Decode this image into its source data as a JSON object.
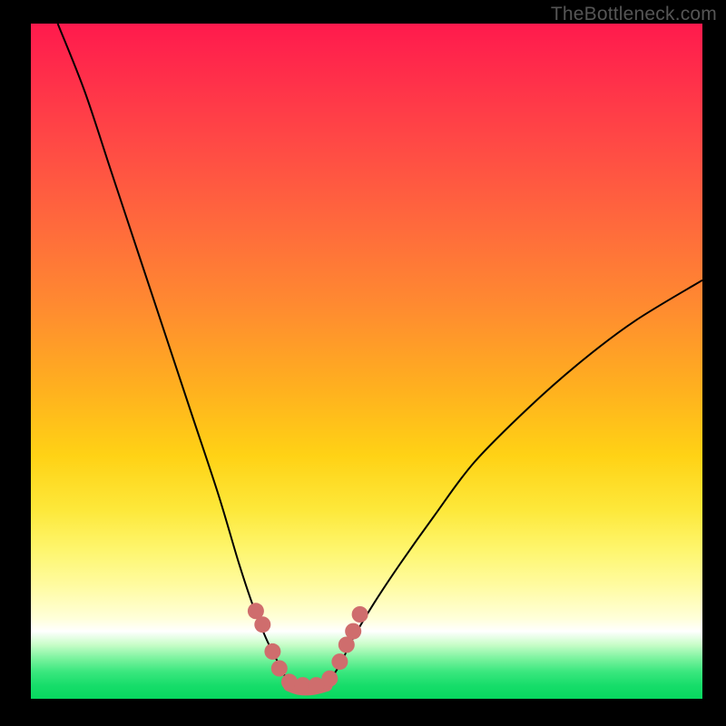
{
  "watermark": "TheBottleneck.com",
  "chart_data": {
    "type": "line",
    "title": "",
    "xlabel": "",
    "ylabel": "",
    "xlim": [
      0,
      100
    ],
    "ylim": [
      0,
      100
    ],
    "grid": false,
    "legend": false,
    "annotations": [],
    "series": [
      {
        "name": "left-curve",
        "x": [
          4,
          8,
          12,
          16,
          20,
          24,
          28,
          31,
          33,
          35,
          37,
          38.5
        ],
        "y": [
          100,
          90,
          78,
          66,
          54,
          42,
          30,
          20,
          14,
          9,
          5,
          2
        ]
      },
      {
        "name": "right-curve",
        "x": [
          44,
          46,
          48,
          51,
          55,
          60,
          66,
          74,
          82,
          90,
          100
        ],
        "y": [
          2,
          5,
          9,
          14,
          20,
          27,
          35,
          43,
          50,
          56,
          62
        ]
      },
      {
        "name": "valley-floor",
        "x": [
          38.5,
          40,
          42,
          44
        ],
        "y": [
          2,
          1.5,
          1.5,
          2
        ]
      }
    ],
    "markers": {
      "name": "dots",
      "color": "#cf6d6d",
      "points": [
        {
          "x": 33.5,
          "y": 13
        },
        {
          "x": 34.5,
          "y": 11
        },
        {
          "x": 36,
          "y": 7
        },
        {
          "x": 37,
          "y": 4.5
        },
        {
          "x": 38.5,
          "y": 2.5
        },
        {
          "x": 40.5,
          "y": 2
        },
        {
          "x": 42.5,
          "y": 2
        },
        {
          "x": 44.5,
          "y": 3
        },
        {
          "x": 46,
          "y": 5.5
        },
        {
          "x": 47,
          "y": 8
        },
        {
          "x": 48,
          "y": 10
        },
        {
          "x": 49,
          "y": 12.5
        }
      ]
    },
    "colors": {
      "curve": "#000000",
      "marker": "#cf6d6d",
      "gradient_top": "#ff1a4d",
      "gradient_mid": "#ffd215",
      "gradient_bottom": "#07d85f"
    }
  }
}
